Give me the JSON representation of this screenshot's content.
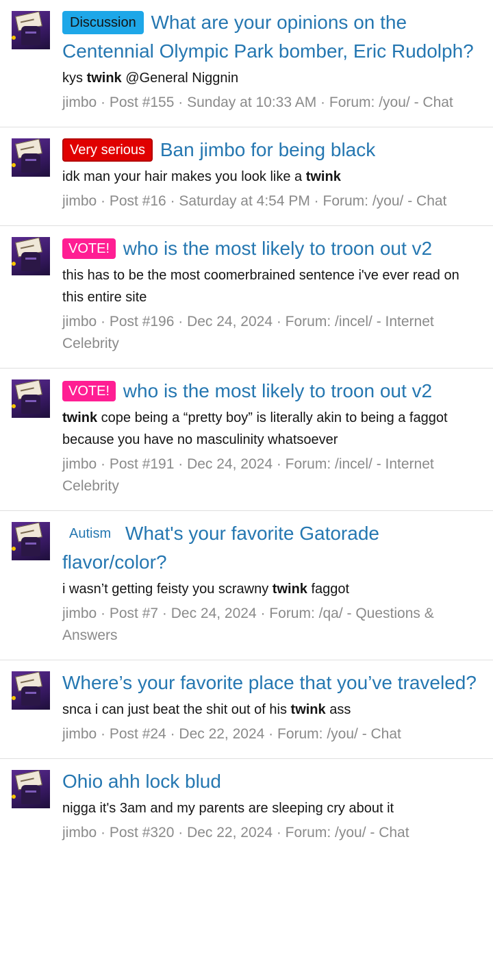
{
  "results": [
    {
      "prefix": "Discussion",
      "prefix_style": "discussion",
      "title": "What are your opinions on the Centennial Olympic Park bomber, Eric Rudolph?",
      "snippet": [
        {
          "t": "kys ",
          "b": false
        },
        {
          "t": "twink",
          "b": true
        },
        {
          "t": " @General Niggnin",
          "b": false
        }
      ],
      "meta": "jimbo · Post #155 · Sunday at 10:33 AM · Forum: /you/ - Chat"
    },
    {
      "prefix": "Very serious",
      "prefix_style": "serious",
      "title": "Ban jimbo for being black",
      "snippet": [
        {
          "t": "idk man your hair makes you look like a ",
          "b": false
        },
        {
          "t": "twink",
          "b": true
        }
      ],
      "meta": "jimbo · Post #16 · Saturday at 4:54 PM · Forum: /you/ - Chat"
    },
    {
      "prefix": "VOTE!",
      "prefix_style": "vote",
      "title": "who is the most likely to troon out v2",
      "snippet": [
        {
          "t": "this has to be the most coomerbrained sentence i've ever read on this entire site",
          "b": false
        }
      ],
      "meta": "jimbo · Post #196 · Dec 24, 2024 · Forum: /incel/ - Internet Celebrity"
    },
    {
      "prefix": "VOTE!",
      "prefix_style": "vote",
      "title": "who is the most likely to troon out v2",
      "snippet": [
        {
          "t": "twink",
          "b": true
        },
        {
          "t": " cope being a “pretty boy” is literally akin to being a faggot because you have no masculinity whatsoever",
          "b": false
        }
      ],
      "meta": "jimbo · Post #191 · Dec 24, 2024 · Forum: /incel/ - Internet Celebrity"
    },
    {
      "prefix": "Autism",
      "prefix_style": "plain",
      "title": "What's your favorite Gatorade flavor/color?",
      "snippet": [
        {
          "t": "i wasn’t getting feisty you scrawny ",
          "b": false
        },
        {
          "t": "twink",
          "b": true
        },
        {
          "t": " faggot",
          "b": false
        }
      ],
      "meta": "jimbo · Post #7 · Dec 24, 2024 · Forum: /qa/ - Questions & Answers"
    },
    {
      "prefix": "",
      "prefix_style": "none",
      "title": "Where’s your favorite place that you’ve traveled?",
      "snippet": [
        {
          "t": "snca i can just beat the shit out of his ",
          "b": false
        },
        {
          "t": "twink",
          "b": true
        },
        {
          "t": " ass",
          "b": false
        }
      ],
      "meta": "jimbo · Post #24 · Dec 22, 2024 · Forum: /you/ - Chat"
    },
    {
      "prefix": "",
      "prefix_style": "none",
      "title": "Ohio ahh lock blud",
      "snippet": [
        {
          "t": "nigga it's 3am and my parents are sleeping cry about it",
          "b": false
        }
      ],
      "meta": "jimbo · Post #320 · Dec 22, 2024 · Forum: /you/ - Chat"
    }
  ]
}
